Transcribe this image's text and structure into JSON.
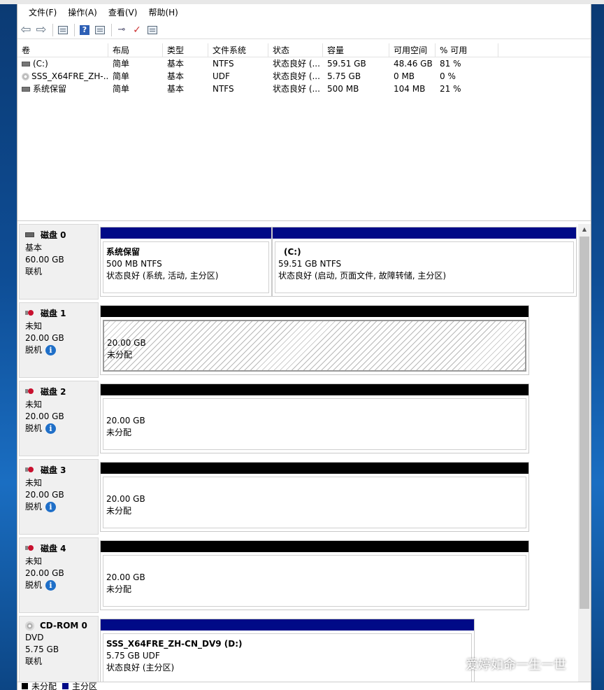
{
  "menu": [
    "文件(F)",
    "操作(A)",
    "查看(V)",
    "帮助(H)"
  ],
  "toolbar": {
    "icons": [
      "back-arrow-icon",
      "forward-arrow-icon",
      "console-tree-icon",
      "help-icon",
      "properties-icon",
      "connect-icon",
      "check-icon",
      "list-icon"
    ]
  },
  "volume_table": {
    "headers": [
      "卷",
      "布局",
      "类型",
      "文件系统",
      "状态",
      "容量",
      "可用空间",
      "% 可用"
    ],
    "rows": [
      {
        "name": "(C:)",
        "layout": "简单",
        "type": "基本",
        "fs": "NTFS",
        "status": "状态良好 (...",
        "capacity": "59.51 GB",
        "free": "48.46 GB",
        "pct": "81 %"
      },
      {
        "name": "SSS_X64FRE_ZH-...",
        "layout": "简单",
        "type": "基本",
        "fs": "UDF",
        "status": "状态良好 (...",
        "capacity": "5.75 GB",
        "free": "0 MB",
        "pct": "0 %"
      },
      {
        "name": "系统保留",
        "layout": "简单",
        "type": "基本",
        "fs": "NTFS",
        "status": "状态良好 (...",
        "capacity": "500 MB",
        "free": "104 MB",
        "pct": "21 %"
      }
    ]
  },
  "disks": [
    {
      "title": "磁盘 0",
      "kind": "基本",
      "size": "60.00 GB",
      "state": "联机",
      "partitions": [
        {
          "title": "系统保留",
          "size": "500 MB NTFS",
          "status": "状态良好 (系统, 活动, 主分区)"
        },
        {
          "title": "(C:)",
          "size": "59.51 GB NTFS",
          "status": "状态良好 (启动, 页面文件, 故障转储, 主分区)"
        }
      ]
    },
    {
      "title": "磁盘 1",
      "kind": "未知",
      "size": "20.00 GB",
      "state": "脱机",
      "unalloc_size": "20.00 GB",
      "unalloc_label": "未分配"
    },
    {
      "title": "磁盘 2",
      "kind": "未知",
      "size": "20.00 GB",
      "state": "脱机",
      "unalloc_size": "20.00 GB",
      "unalloc_label": "未分配"
    },
    {
      "title": "磁盘 3",
      "kind": "未知",
      "size": "20.00 GB",
      "state": "脱机",
      "unalloc_size": "20.00 GB",
      "unalloc_label": "未分配"
    },
    {
      "title": "磁盘 4",
      "kind": "未知",
      "size": "20.00 GB",
      "state": "脱机",
      "unalloc_size": "20.00 GB",
      "unalloc_label": "未分配"
    },
    {
      "title": "CD-ROM 0",
      "kind": "DVD",
      "size": "5.75 GB",
      "state": "联机",
      "partitions": [
        {
          "title": "SSS_X64FRE_ZH-CN_DV9  (D:)",
          "size": "5.75 GB UDF",
          "status": "状态良好 (主分区)"
        }
      ]
    }
  ],
  "legend": [
    {
      "label": "未分配",
      "color": "#000000"
    },
    {
      "label": "主分区",
      "color": "#000a87"
    }
  ],
  "watermark": "爱婷如命一生一世",
  "colors": {
    "primary_partition": "#000a87",
    "unallocated": "#000000",
    "offline": "#c8102e"
  }
}
